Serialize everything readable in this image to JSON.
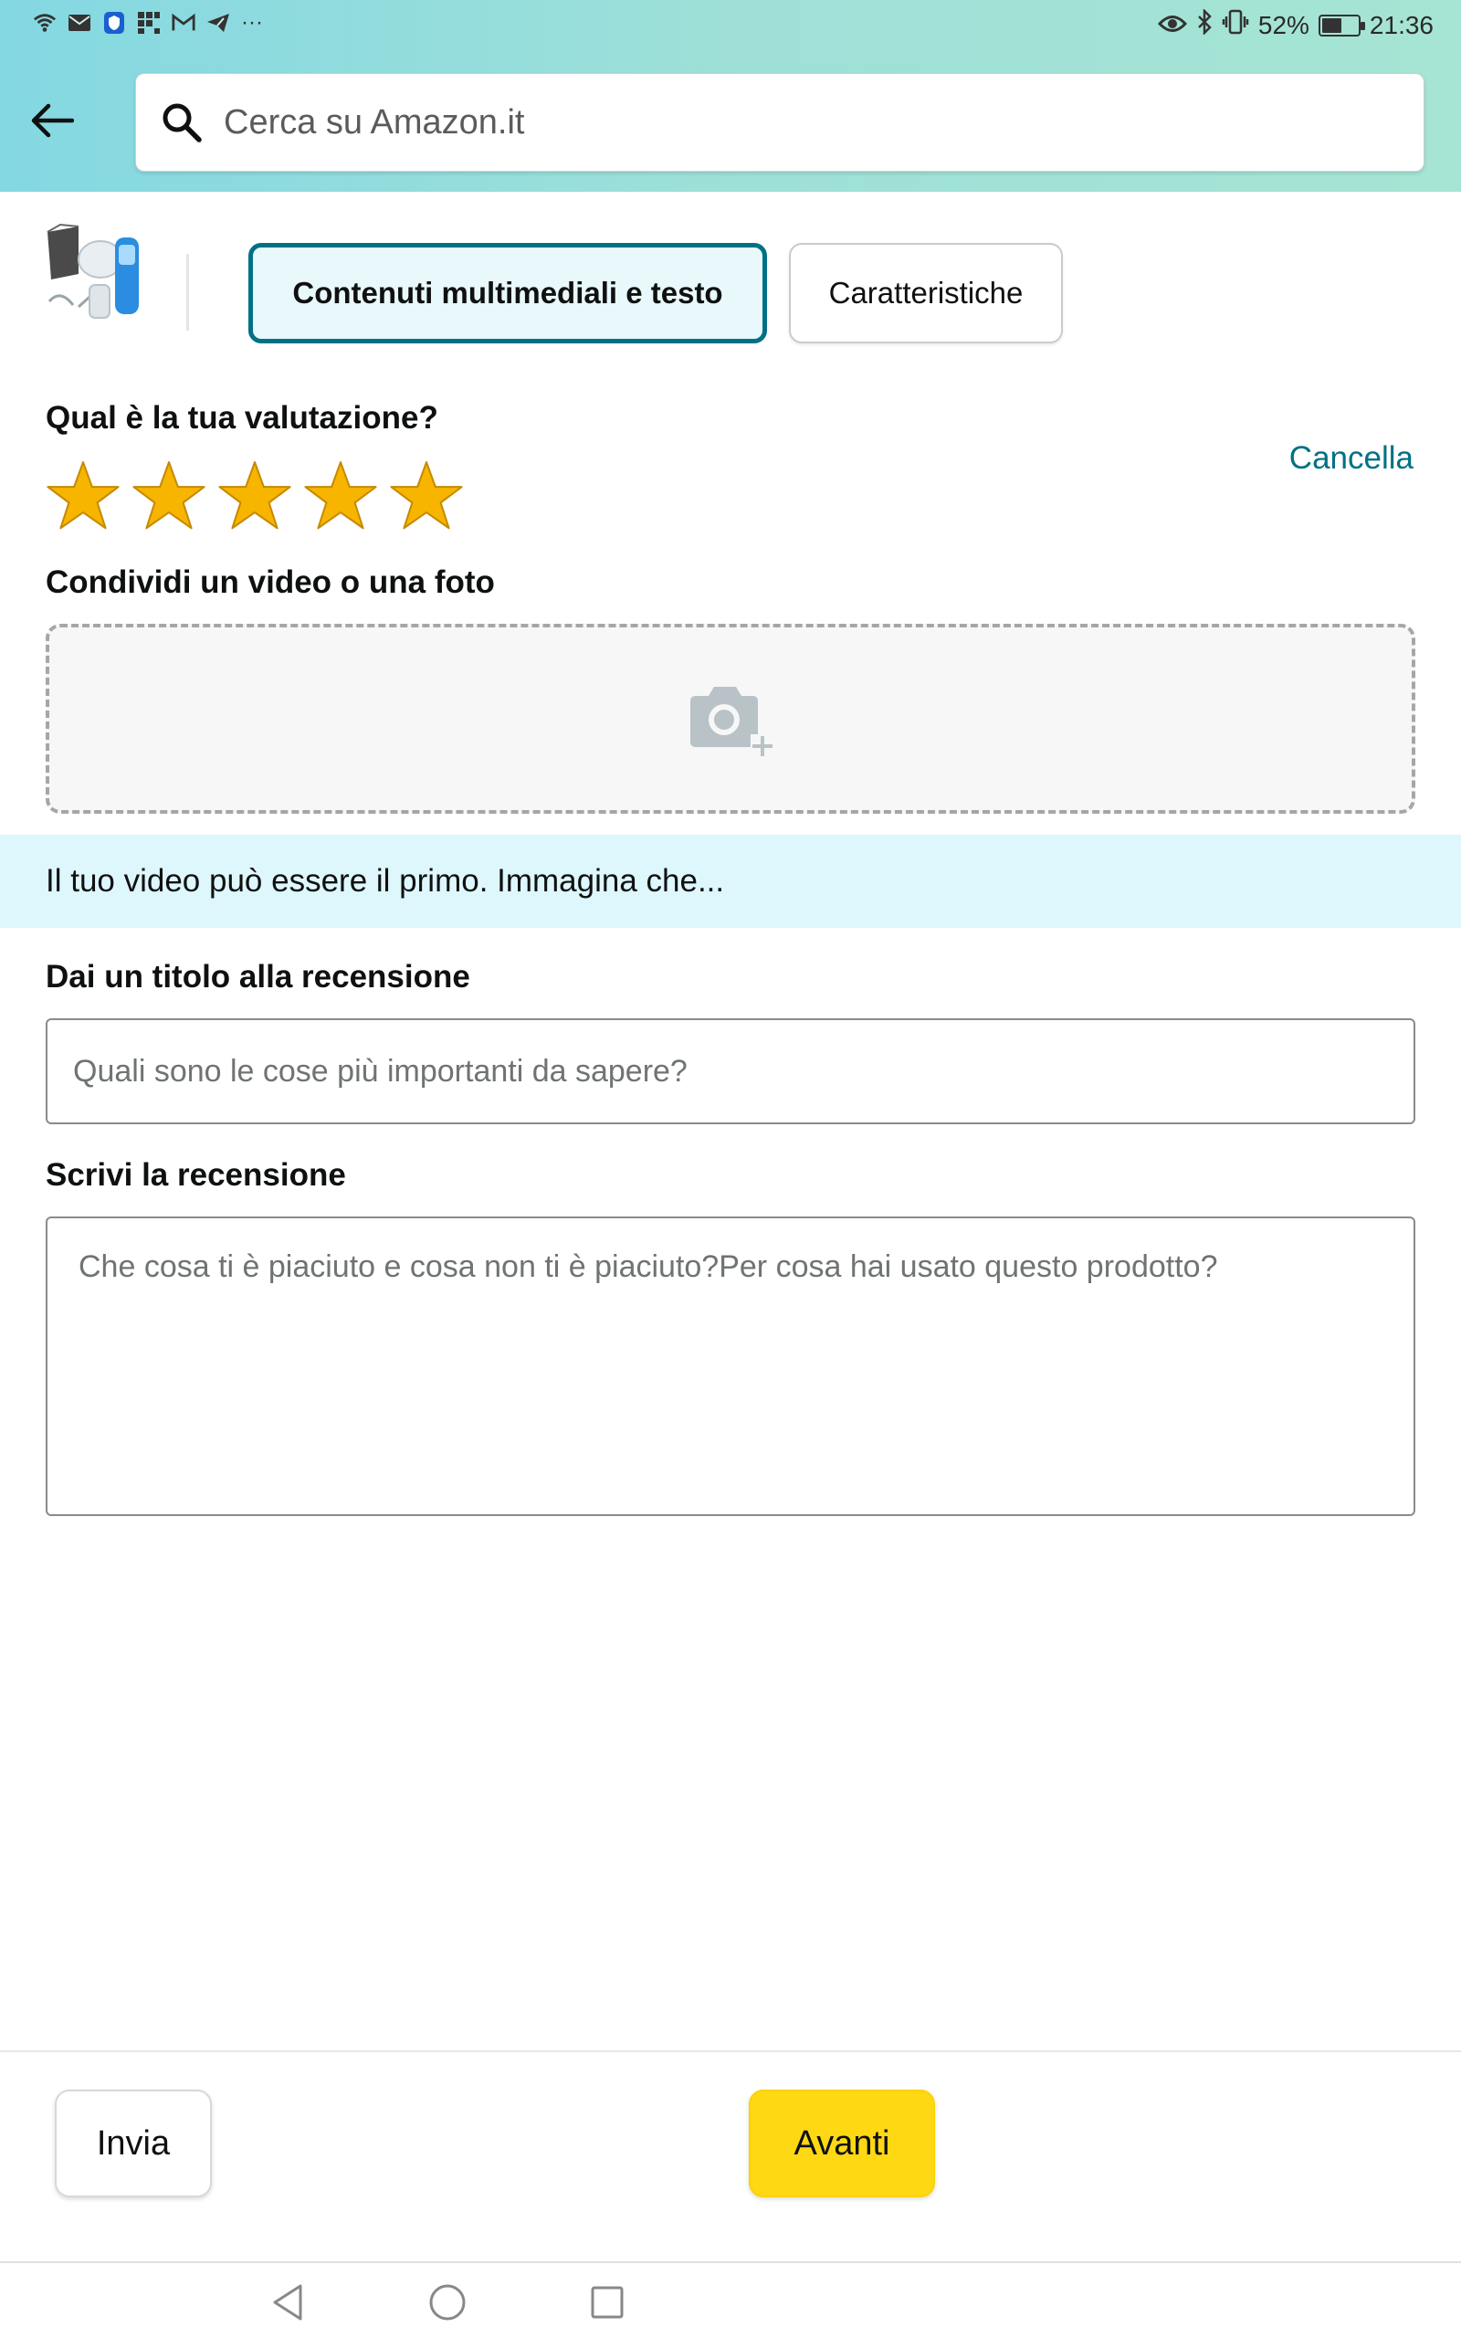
{
  "status_bar": {
    "battery_percent": "52%",
    "battery_level": 0.52,
    "time": "21:36",
    "left_icons": [
      "wifi-icon",
      "mail-icon",
      "shield-icon",
      "app-grid-icon",
      "gmail-icon",
      "telegram-icon",
      "more-notifications-icon"
    ],
    "more_indicator": "···",
    "right_icons": [
      "eye-icon",
      "bluetooth-icon",
      "vibrate-icon",
      "battery-icon"
    ]
  },
  "header": {
    "search_placeholder": "Cerca su Amazon.it"
  },
  "tabs": [
    {
      "label": "Contenuti multimediali e testo",
      "active": true
    },
    {
      "label": "Caratteristiche",
      "active": false
    }
  ],
  "rating": {
    "label": "Qual è la tua valutazione?",
    "cancel_label": "Cancella",
    "stars": 5,
    "max_stars": 5
  },
  "media": {
    "label": "Condividi un video o una foto"
  },
  "banner": {
    "text": "Il tuo video può essere il primo. Immagina che..."
  },
  "title_field": {
    "label": "Dai un titolo alla recensione",
    "placeholder": "Quali sono le cose più importanti da sapere?"
  },
  "review_field": {
    "label": "Scrivi la recensione",
    "placeholder": "Che cosa ti è piaciuto e cosa non ti è piaciuto?Per cosa hai usato questo prodotto?"
  },
  "footer": {
    "submit_label": "Invia",
    "next_label": "Avanti"
  },
  "colors": {
    "accent_teal": "#007185",
    "cta_yellow": "#ffd814",
    "star_gold": "#f7b500",
    "banner_bg": "#def7fc"
  }
}
